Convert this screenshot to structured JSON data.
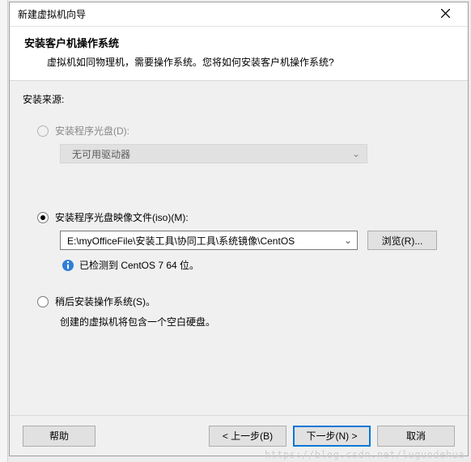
{
  "window": {
    "title": "新建虚拟机向导",
    "close_name": "close"
  },
  "header": {
    "title": "安装客户机操作系统",
    "subtitle": "虚拟机如同物理机，需要操作系统。您将如何安装客户机操作系统?"
  },
  "source": {
    "group_label": "安装来源:",
    "option_disc": {
      "label": "安装程序光盘(D):",
      "dropdown_value": "无可用驱动器"
    },
    "option_iso": {
      "label": "安装程序光盘映像文件(iso)(M):",
      "path_value": "E:\\myOfficeFile\\安装工具\\协同工具\\系统镜像\\CentOS",
      "browse_label": "浏览(R)...",
      "detected_text": "已检测到 CentOS 7 64 位。"
    },
    "option_later": {
      "label": "稍后安装操作系统(S)。",
      "note": "创建的虚拟机将包含一个空白硬盘。"
    }
  },
  "footer": {
    "help": "帮助",
    "back": "< 上一步(B)",
    "next": "下一步(N) >",
    "cancel": "取消"
  },
  "watermark": "https://blog.csdn.net/luguodehua"
}
